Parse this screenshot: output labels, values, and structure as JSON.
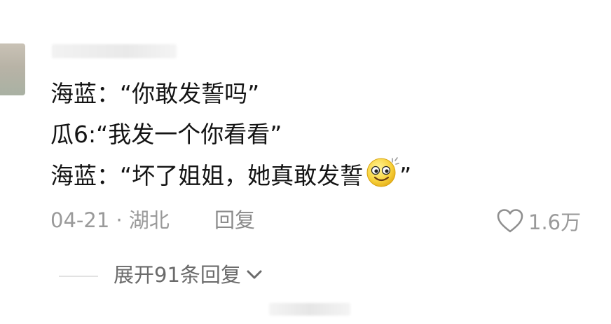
{
  "comment": {
    "lines": [
      "海蓝：“你敢发誓吗”",
      "瓜6:“我发一个你看看”",
      "海蓝：“坏了姐姐，她真敢发誓",
      "”"
    ],
    "emoji_icon": "smile-sparkle-emoji",
    "date_location": "04-21 · 湖北",
    "reply_label": "回复",
    "like_count": "1.6万"
  },
  "replies": {
    "expand_label": "展开91条回复"
  },
  "colors": {
    "text": "#141414",
    "meta": "#9a9a9a",
    "expand": "#6b6b6b"
  }
}
